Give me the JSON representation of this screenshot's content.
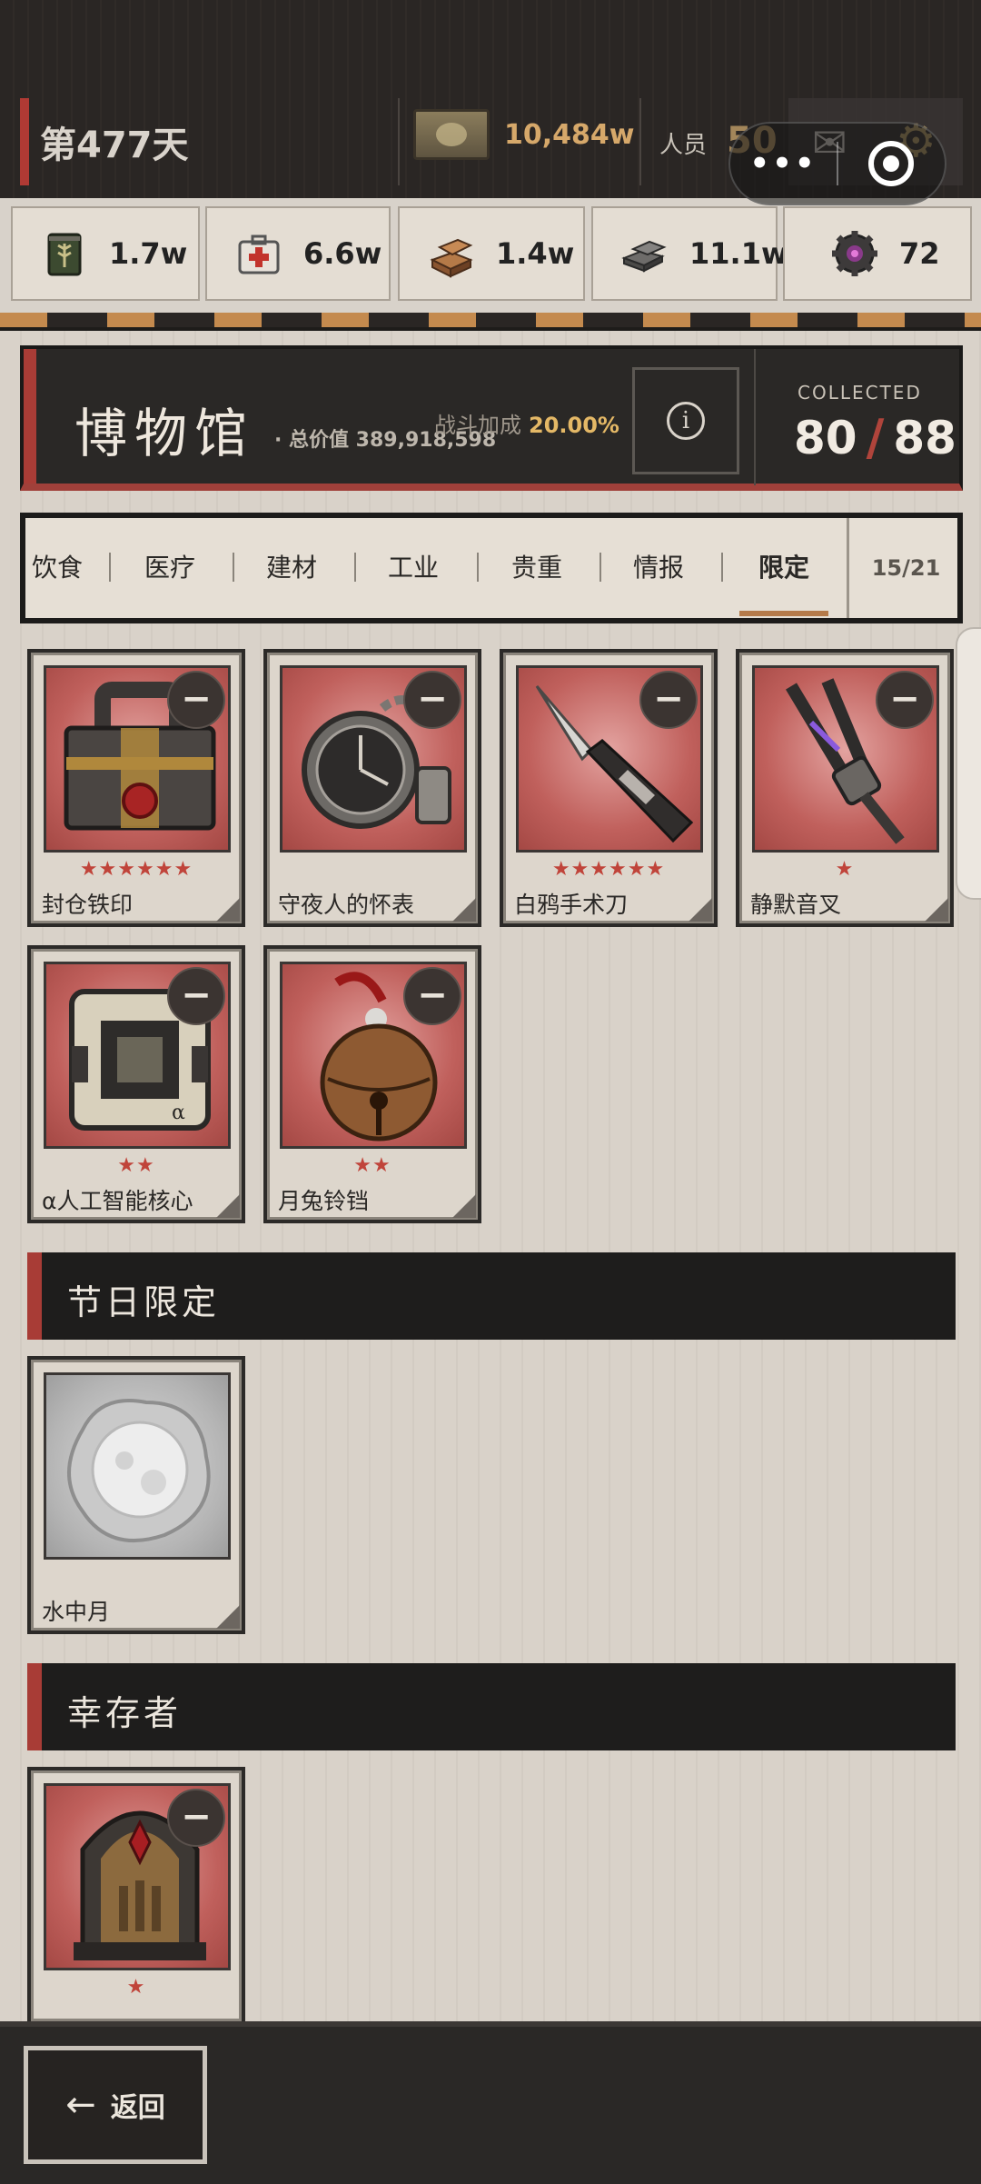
{
  "topbar": {
    "day": "第477天",
    "money": "10,484w",
    "staff_label": "人员",
    "staff_value": "50"
  },
  "resources": [
    {
      "icon": "grain-can-icon",
      "value": "1.7w"
    },
    {
      "icon": "medkit-icon",
      "value": "6.6w"
    },
    {
      "icon": "bricks-icon",
      "value": "1.4w"
    },
    {
      "icon": "steel-ingot-icon",
      "value": "11.1w"
    },
    {
      "icon": "gear-chip-icon",
      "value": "72"
    }
  ],
  "museum": {
    "title": "博物馆",
    "total_value": "· 总价值 389,918,598",
    "bonus_label": "战斗加成",
    "bonus_value": "20.00%",
    "collected_label": "COLLECTED",
    "collected": "80",
    "total": "88"
  },
  "tabs": {
    "items": [
      "饮食",
      "医疗",
      "建材",
      "工业",
      "贵重",
      "情报",
      "限定"
    ],
    "active": "限定",
    "count": "15/21"
  },
  "items_main": [
    {
      "name": "封仓铁印",
      "stars": "★★★★★★",
      "art": "iron-seal-box-icon"
    },
    {
      "name": "守夜人的怀表",
      "stars": "",
      "art": "pocket-watch-icon"
    },
    {
      "name": "白鸦手术刀",
      "stars": "★★★★★★",
      "art": "scalpel-icon"
    },
    {
      "name": "静默音叉",
      "stars": "★",
      "art": "tuning-fork-icon"
    },
    {
      "name": "α人工智能核心",
      "stars": "★★",
      "art": "ai-core-icon"
    },
    {
      "name": "月兔铃铛",
      "stars": "★★",
      "art": "bell-icon"
    }
  ],
  "section_holiday": {
    "title": "节日限定",
    "items": [
      {
        "name": "水中月",
        "stars": "",
        "art": "moon-in-water-icon"
      }
    ]
  },
  "section_survivor": {
    "title": "幸存者",
    "items": [
      {
        "name": "",
        "stars": "★",
        "art": "survivor-monument-icon"
      }
    ]
  },
  "footer": {
    "back_label": "返回"
  },
  "capsule": {
    "dots": "•••"
  }
}
